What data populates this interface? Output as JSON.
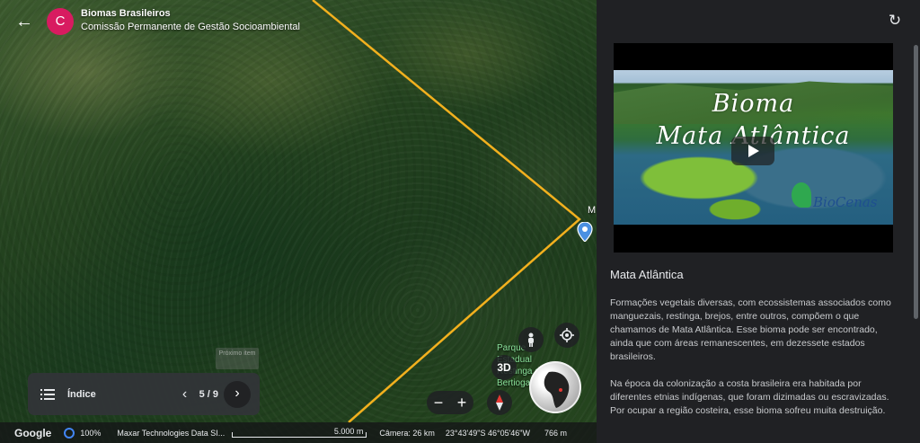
{
  "header": {
    "avatar_letter": "C",
    "title": "Biomas Brasileiros",
    "subtitle": "Comissão Permanente de Gestão Socioambiental"
  },
  "map": {
    "pin_label": "M",
    "place_label": "Parque Estadual Restinga de Bertioga",
    "next_place_card": "Próximo item",
    "route_color": "#f2b01e"
  },
  "index_bar": {
    "label": "Índice",
    "page": "5 / 9"
  },
  "controls": {
    "toggle_3d": "3D"
  },
  "status_bar": {
    "google": "Google",
    "loading_percent": "100%",
    "attribution": "Maxar Technologies  Data SI...",
    "scale": "5.000 m",
    "camera": "Câmera: 26 km",
    "coordinates": "23°43'49\"S 46°05'46\"W",
    "elevation": "766 m"
  },
  "panel": {
    "video_title_line1": "Bioma",
    "video_title_line2": "Mata Atlântica",
    "video_logo_text": "BioCenas",
    "content_title": "Mata Atlântica",
    "paragraphs": [
      "Formações vegetais diversas, com ecossistemas associados como manguezais, restinga, brejos, entre outros, compõem o que chamamos de Mata Atlântica. Esse bioma pode ser encontrado, ainda que com áreas remanescentes, em dezessete estados brasileiros.",
      "Na época da colonização a costa brasileira era habitada por diferentes etnias indígenas, que foram dizimadas ou escravizadas. Por ocupar a região costeira, esse bioma sofreu muita destruição."
    ]
  }
}
